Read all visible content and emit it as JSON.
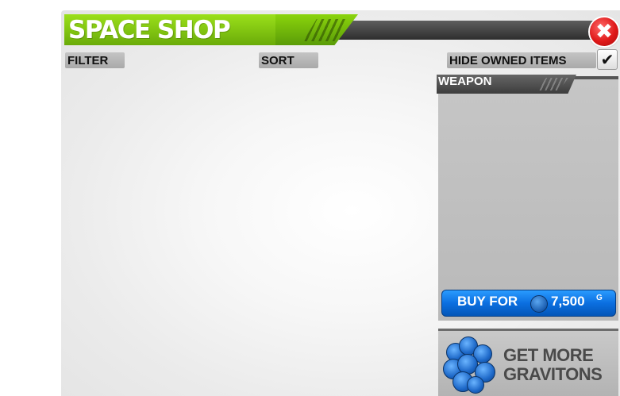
{
  "shop": {
    "title": "SPACE SHOP",
    "close_symbol": "✖"
  },
  "toolbar": {
    "filter_label": "FILTER",
    "sort_label": "SORT",
    "hide_owned_label": "HIDE OWNED ITEMS",
    "hide_owned_checked": true,
    "check_symbol": "✔"
  },
  "item_card": {
    "category": "WEAPON",
    "buy_label": "BUY FOR",
    "price": "7,500",
    "currency_unit": "G"
  },
  "promo": {
    "text_line1": "GET MORE",
    "text_line2": "GRAVITONS"
  },
  "colors": {
    "title_green": "#7cc40b",
    "buy_blue": "#0b6fe0",
    "close_red": "#e01919"
  },
  "icons": [
    "close-icon",
    "checkmark-icon",
    "graviton-coin-icon",
    "graviton-coin-stack-icon"
  ]
}
